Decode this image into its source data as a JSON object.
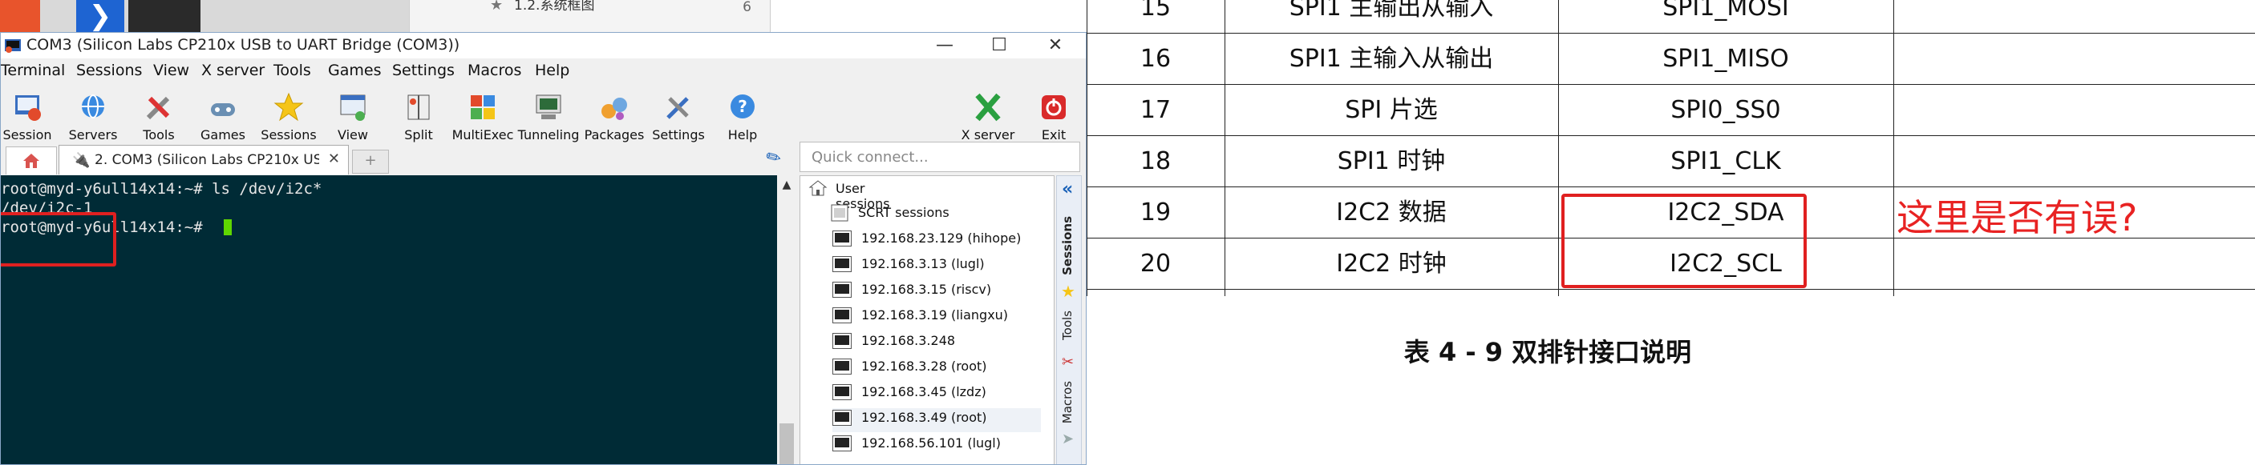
{
  "background": {
    "doc_sidebar_text": "1.2.系统框图",
    "doc_sidebar_num": "6",
    "app2_glyph": "❯"
  },
  "window": {
    "title": "COM3  (Silicon Labs CP210x USB to UART Bridge (COM3))",
    "min": "—",
    "max": "☐",
    "close": "✕"
  },
  "menu": [
    "Terminal",
    "Sessions",
    "View",
    "X server",
    "Tools",
    "Games",
    "Settings",
    "Macros",
    "Help"
  ],
  "toolbar": [
    {
      "label": "Session",
      "icon": "session-icon"
    },
    {
      "label": "Servers",
      "icon": "servers-icon"
    },
    {
      "label": "Tools",
      "icon": "tools-icon"
    },
    {
      "label": "Games",
      "icon": "games-icon"
    },
    {
      "label": "Sessions",
      "icon": "star-icon"
    },
    {
      "label": "View",
      "icon": "view-icon"
    },
    {
      "label": "Split",
      "icon": "split-icon"
    },
    {
      "label": "MultiExec",
      "icon": "multiexec-icon"
    },
    {
      "label": "Tunneling",
      "icon": "tunneling-icon"
    },
    {
      "label": "Packages",
      "icon": "packages-icon"
    },
    {
      "label": "Settings",
      "icon": "settings-icon"
    },
    {
      "label": "Help",
      "icon": "help-icon"
    }
  ],
  "toolbar_right": [
    {
      "label": "X server",
      "icon": "xserver-icon"
    },
    {
      "label": "Exit",
      "icon": "exit-icon"
    }
  ],
  "tabs": {
    "main_label": "2. COM3  (Silicon Labs CP210x USB t",
    "close": "✕",
    "new": "+"
  },
  "terminal": {
    "lines": [
      "root@myd-y6ull14x14:~# ls /dev/i2c*",
      "/dev/i2c-1",
      "root@myd-y6ull14x14:~# "
    ]
  },
  "quick_connect": {
    "placeholder": "Quick connect..."
  },
  "sessions": {
    "root": "User sessions",
    "folder": "SCRT sessions",
    "items": [
      "192.168.23.129 (hihope)",
      "192.168.3.13 (lugl)",
      "192.168.3.15 (riscv)",
      "192.168.3.19 (liangxu)",
      "192.168.3.248",
      "192.168.3.28 (root)",
      "192.168.3.45 (lzdz)",
      "192.168.3.49 (root)",
      "192.168.56.101 (lugl)"
    ]
  },
  "vsidebar": {
    "sessions": "Sessions",
    "tools": "Tools",
    "macros": "Macros",
    "collapse": "«"
  },
  "doc": {
    "rows": [
      {
        "no": "15",
        "func": "SPI1 主输出从输入",
        "sig": "SPI1_MOSI"
      },
      {
        "no": "16",
        "func": "SPI1 主输入从输出",
        "sig": "SPI1_MISO"
      },
      {
        "no": "17",
        "func": "SPI 片选",
        "sig": "SPI0_SS0"
      },
      {
        "no": "18",
        "func": "SPI1 时钟",
        "sig": "SPI1_CLK"
      },
      {
        "no": "19",
        "func": "I2C2 数据",
        "sig": "I2C2_SDA"
      },
      {
        "no": "20",
        "func": "I2C2 时钟",
        "sig": "I2C2_SCL"
      }
    ],
    "caption": "表 4 - 9 双排针接口说明",
    "annotation": "这里是否有误?"
  },
  "colors": {
    "terminal_bg": "#002b36",
    "cursor": "#5fd700",
    "highlight_red": "#e02020",
    "annotation_red": "#e82222"
  }
}
